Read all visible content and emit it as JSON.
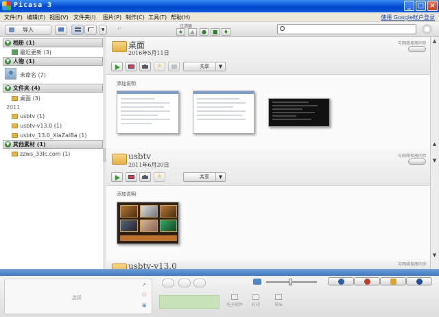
{
  "window": {
    "title": "Picasa 3"
  },
  "menu": {
    "items": [
      "文件(F)",
      "编辑(E)",
      "视图(V)",
      "文件夹(I)",
      "图片(P)",
      "制作(C)",
      "工具(T)",
      "帮助(H)"
    ],
    "signin": "使用 Google帐户登录"
  },
  "toolbar": {
    "import_label": "导入",
    "filters_label": "过滤器",
    "search_placeholder": ""
  },
  "left_panel": {
    "sections": {
      "albums": "相册 (1)",
      "people": "人物 (1)",
      "folders": "文件夹 (4)",
      "other": "其他素材 (1)"
    },
    "albums_items": [
      "最近更新 (3)"
    ],
    "people_items": [
      "未命名 (7)"
    ],
    "folders_items": [
      "桌面 (3)"
    ],
    "year": "2011",
    "year_items": [
      "usbtv (1)",
      "usbtv-v13.0 (1)",
      "usbtv_13.0_XiaZaiBa (1)"
    ],
    "other_items": [
      "zzws_33lc.com (1)"
    ]
  },
  "main": {
    "albums": [
      {
        "title": "桌面",
        "date": "2016年5月11日",
        "sync_label": "与网络相册同步",
        "share_label": "共享",
        "caption": "添加说明"
      },
      {
        "title": "usbtv",
        "date": "2011年6月20日",
        "sync_label": "与网络相册同步",
        "share_label": "共享",
        "caption": "添加说明"
      },
      {
        "title": "usbtv-v13.0",
        "sync_label": "与网络相册同步"
      }
    ]
  },
  "tray": {
    "hold_label": "选择",
    "actions": [
      "电子邮件",
      "打印",
      "导出"
    ]
  },
  "colors": {
    "titlebar": "#0a55d8",
    "tray_band": "#3f78c2",
    "section_toggle": "#3c8d3c",
    "folder": "#e5b044"
  },
  "icons": {
    "filters": [
      "star-icon",
      "upload-icon",
      "face-icon",
      "video-icon",
      "geotag-icon"
    ],
    "tray_buttons": [
      "people-icon",
      "places-icon",
      "tags-icon",
      "info-icon"
    ]
  }
}
